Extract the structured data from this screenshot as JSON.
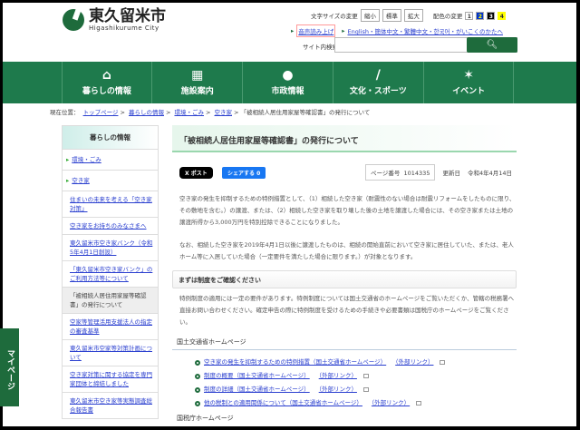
{
  "header": {
    "logo_name": "東久留米市",
    "logo_sub": "Higashikurume City",
    "font_size_label": "文字サイズの変更",
    "font_sizes": [
      "縮小",
      "標準",
      "拡大"
    ],
    "color_label": "配色の変更",
    "colors": [
      "1",
      "2",
      "3",
      "4"
    ],
    "read_aloud": "音声読み上げ",
    "languages": "English・簡体中文・繁體中文・한국어・がいこくのかたへ",
    "search_label": "サイト内検索",
    "search_value": "",
    "search_icon": "magnifier"
  },
  "nav": [
    {
      "label": "暮らしの情報",
      "icon": "house-icon"
    },
    {
      "label": "施設案内",
      "icon": "building-icon"
    },
    {
      "label": "市政情報",
      "icon": "city-mark-icon"
    },
    {
      "label": "文化・スポーツ",
      "icon": "baton-icon"
    },
    {
      "label": "イベント",
      "icon": "party-icon"
    }
  ],
  "breadcrumb": {
    "label": "現在位置：",
    "links": [
      "トップページ",
      "暮らしの情報",
      "環境・ごみ",
      "空き家"
    ],
    "current": "「被相続人居住用家屋等確認書」の発行について"
  },
  "sidebar": {
    "title": "暮らしの情報",
    "top": [
      "環境・ごみ",
      "空き家"
    ],
    "items": [
      "住まいの未来を考える「空き家対策」",
      "空き家をお持ちのみなさまへ",
      "東久留米市空き家バンク（令和5年4月1日創設）",
      "「東久留米市空き家バンク」のご利用方法等について",
      "「被相続人居住用家屋等確認書」の発行について",
      "空家等管理活用支援法人の指定の審査基準",
      "東久留米市空家等対策計画について",
      "空き家対策に関する協定を専門家団体と締結しました",
      "東久留米市空き家等実態調査総合報告書"
    ]
  },
  "mypage": "マイページ",
  "main": {
    "title": "「被相続人居住用家屋等確認書」の発行について",
    "x_post": "X ポスト",
    "fb_share": "シェアする 0",
    "page_no_label": "ページ番号",
    "page_no": "1014335",
    "updated_label": "更新日",
    "updated": "令和4年4月14日",
    "para1": "空き家の発生を抑制するための特例措置として、（1）相続した空き家（耐震性のない場合は耐震リフォームをしたものに限り、その敷地を含む。）の譲渡、または、（2）相続した空き家を取り壊した後の土地を譲渡した場合には、その空き家または土地の譲渡所得から3,000万円を特別控除できることになりました。",
    "para2": "なお、相続した空き家を2019年4月1日以後に譲渡したものは、相続の開始直前において空き家に居住していた、または、老人ホーム等に入居していた場合（一定要件を満たした場合に限ります。）が対象となります。",
    "h2": "まずは制度をご確認ください",
    "para3": "特例制度の適用には一定の要件があります。特例制度については国土交通省のホームページをご覧いただくか、管轄の税務署へ直接お問い合わせください。確定申告の際に特例制度を受けるための手続きや必要書類は国税庁のホームページをご覧ください。",
    "h3a": "国土交通省ホームページ",
    "links": [
      "空き家の発生を抑制するための特例措置（国土交通省ホームページ）",
      "制度の概要（国土交通省ホームページ）",
      "制度の詳細（国土交通省ホームページ）",
      "他の税制との適用関係について（国土交通省ホームページ）"
    ],
    "external": "（外部リンク）",
    "h3b": "国税庁ホームページ"
  }
}
